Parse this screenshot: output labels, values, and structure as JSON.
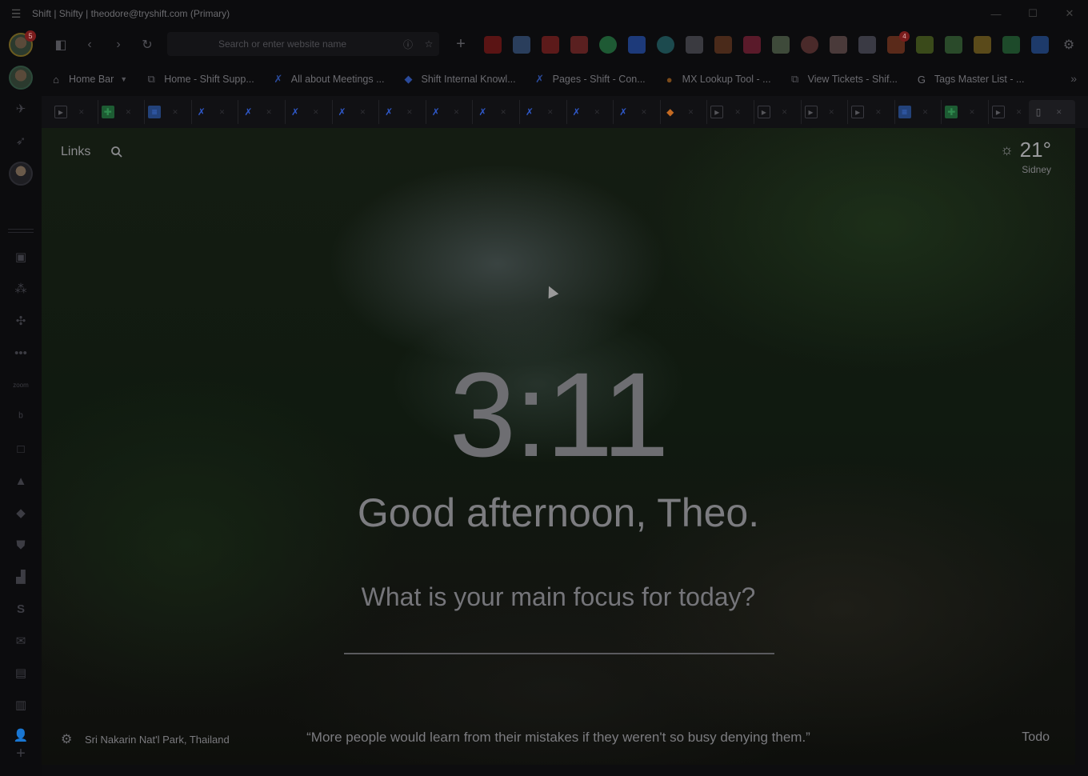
{
  "window": {
    "title": "Shift | Shifty | theodore@tryshift.com (Primary)"
  },
  "rail": {
    "primary_badge": "5"
  },
  "toolbar": {
    "search_placeholder": "Search or enter website name",
    "extensions_badge": "4"
  },
  "bookmarks": [
    {
      "label": "Home Bar",
      "icon": "home-icon"
    },
    {
      "label": "Home - Shift Supp...",
      "icon": "zendesk-icon"
    },
    {
      "label": "All about Meetings ...",
      "icon": "confluence-icon"
    },
    {
      "label": "Shift Internal Knowl...",
      "icon": "diamond-icon"
    },
    {
      "label": "Pages - Shift - Con...",
      "icon": "confluence-icon"
    },
    {
      "label": "MX Lookup Tool - ...",
      "icon": "mx-icon"
    },
    {
      "label": "View Tickets - Shif...",
      "icon": "zendesk-icon"
    },
    {
      "label": "Tags Master List - ...",
      "icon": "google-icon"
    }
  ],
  "tabs": [
    "zendesk",
    "sheets",
    "docs",
    "confluence",
    "confluence",
    "confluence",
    "confluence",
    "confluence",
    "confluence",
    "confluence",
    "confluence",
    "confluence",
    "confluence",
    "gitlab",
    "zendesk",
    "zendesk",
    "zendesk",
    "zendesk",
    "docs",
    "sheets",
    "zendesk"
  ],
  "colors": {
    "sheets": "#1d5c33",
    "docs": "#23427a",
    "confluence": "#1f3f86",
    "gitlab": "#8a4214",
    "zendesk": "#33333a"
  },
  "newtab": {
    "links_label": "Links",
    "weather_temp": "21°",
    "weather_location": "Sidney",
    "time": "3:11",
    "greeting": "Good afternoon, Theo.",
    "focus_question": "What is your main focus for today?",
    "photo_location": "Sri Nakarin Nat'l Park, Thailand",
    "quote": "“More people would learn from their mistakes if they weren't so busy denying them.”",
    "todo_label": "Todo"
  }
}
